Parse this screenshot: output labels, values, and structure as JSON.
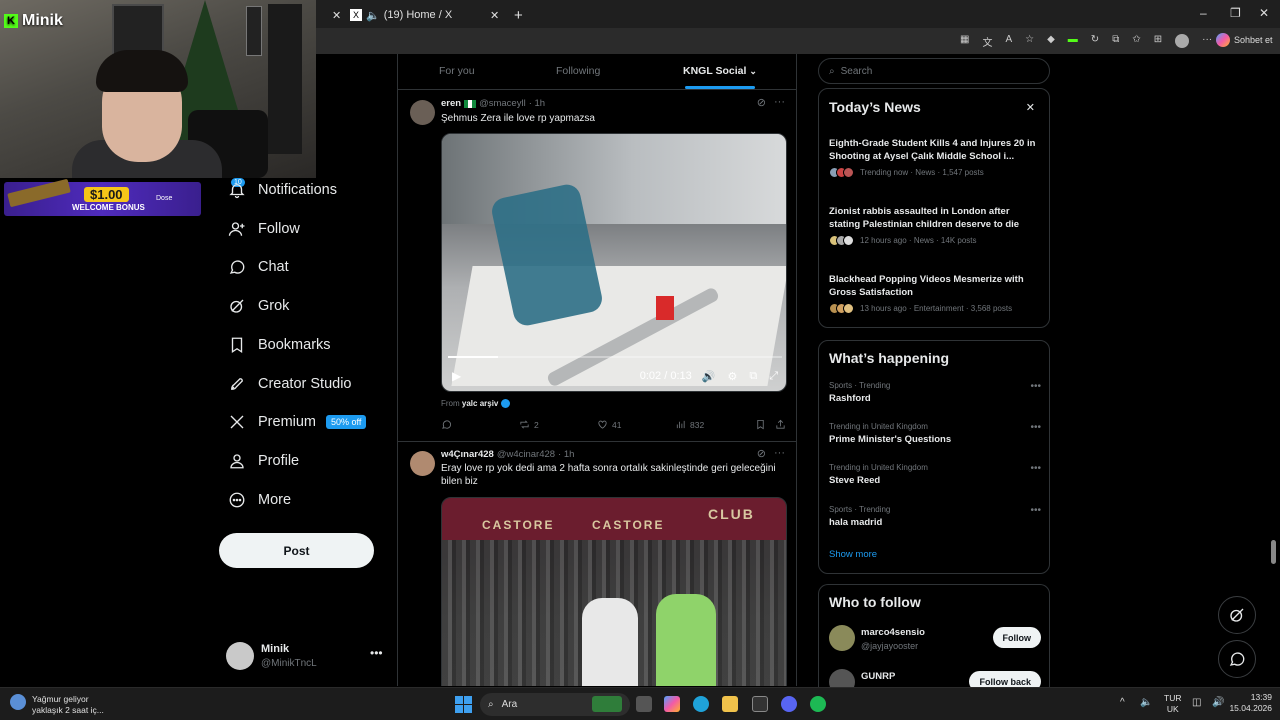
{
  "browser": {
    "tab_title": "(19) Home / X",
    "new_tab": "+",
    "copilot_label": "Sohbet et",
    "window_controls": [
      "–",
      "❐",
      "✕"
    ]
  },
  "stream": {
    "streamer_name": "Minik",
    "bonus_amount": "$1.00",
    "bonus_text": "WELCOME BONUS",
    "bonus_brand": "Dose"
  },
  "nav": {
    "notifications_badge": "10",
    "items": [
      {
        "label": "Notifications",
        "icon": "bell-icon"
      },
      {
        "label": "Follow",
        "icon": "person-add-icon"
      },
      {
        "label": "Chat",
        "icon": "chat-icon"
      },
      {
        "label": "Grok",
        "icon": "grok-icon"
      },
      {
        "label": "Bookmarks",
        "icon": "bookmark-icon"
      },
      {
        "label": "Creator Studio",
        "icon": "rocket-icon"
      },
      {
        "label": "Premium",
        "icon": "x-logo-icon"
      },
      {
        "label": "Profile",
        "icon": "person-icon"
      },
      {
        "label": "More",
        "icon": "more-circle-icon"
      }
    ],
    "premium_badge": "50% off",
    "post_button": "Post",
    "account": {
      "name": "Minik",
      "handle": "@MinikTncL",
      "menu": "•••"
    }
  },
  "feed": {
    "tabs": [
      {
        "label": "For you",
        "active": false
      },
      {
        "label": "Following",
        "active": false
      },
      {
        "label": "KNGL Social",
        "active": true
      }
    ],
    "tweets": [
      {
        "name": "eren",
        "handle": "@smaceyll",
        "time": "· 1h",
        "text": "Şehmus Zera ile love rp yapmazsa",
        "video_time": "0:02 / 0:13",
        "video_progress": 0.15,
        "from_prefix": "From",
        "from_account": "yalc arşiv",
        "replies": "",
        "reposts": "2",
        "likes": "41",
        "views": "832"
      },
      {
        "name": "w4Çınar428",
        "handle": "@w4cinar428",
        "time": "· 1h",
        "text": "Eray love rp yok dedi ama 2 hafta sonra ortalık sakinleştinde geri geleceğini bilen biz",
        "banner_text": "CASTORE",
        "club_text": "CLUB"
      }
    ]
  },
  "search": {
    "placeholder": "Search"
  },
  "todays_news": {
    "title": "Today’s News",
    "close": "✕",
    "items": [
      {
        "title": "Eighth-Grade Student Kills 4 and Injures 20 in Shooting at Aysel Çalık Middle School i...",
        "meta": "Trending now · News · 1,547 posts"
      },
      {
        "title": "Zionist rabbis assaulted in London after stating Palestinian children deserve to die",
        "meta": "12 hours ago · News · 14K posts"
      },
      {
        "title": "Blackhead Popping Videos Mesmerize with Gross Satisfaction",
        "meta": "13 hours ago · Entertainment · 3,568 posts"
      }
    ]
  },
  "whats_happening": {
    "title": "What’s happening",
    "items": [
      {
        "context": "Sports · Trending",
        "title": "Rashford"
      },
      {
        "context": "Trending in United Kingdom",
        "title": "Prime Minister's Questions"
      },
      {
        "context": "Trending in United Kingdom",
        "title": "Steve Reed"
      },
      {
        "context": "Sports · Trending",
        "title": "hala madrid"
      }
    ],
    "show_more": "Show more",
    "more_icon": "•••"
  },
  "who_to_follow": {
    "title": "Who to follow",
    "items": [
      {
        "name": "marco4sensio",
        "handle": "@jayjayooster",
        "button": "Follow"
      },
      {
        "name": "GUNRP",
        "handle": "",
        "button": "Follow back"
      }
    ]
  },
  "taskbar": {
    "weather_title": "Yağmur geliyor",
    "weather_sub": "yaklaşık 2 saat iç...",
    "search_label": "Ara",
    "lang_top": "TUR",
    "lang_bottom": "UK",
    "time": "13:39",
    "date": "15.04.2026"
  },
  "colors": {
    "accent": "#1d9bf0",
    "background": "#000000",
    "border": "#2f3336",
    "muted": "#71767b"
  }
}
